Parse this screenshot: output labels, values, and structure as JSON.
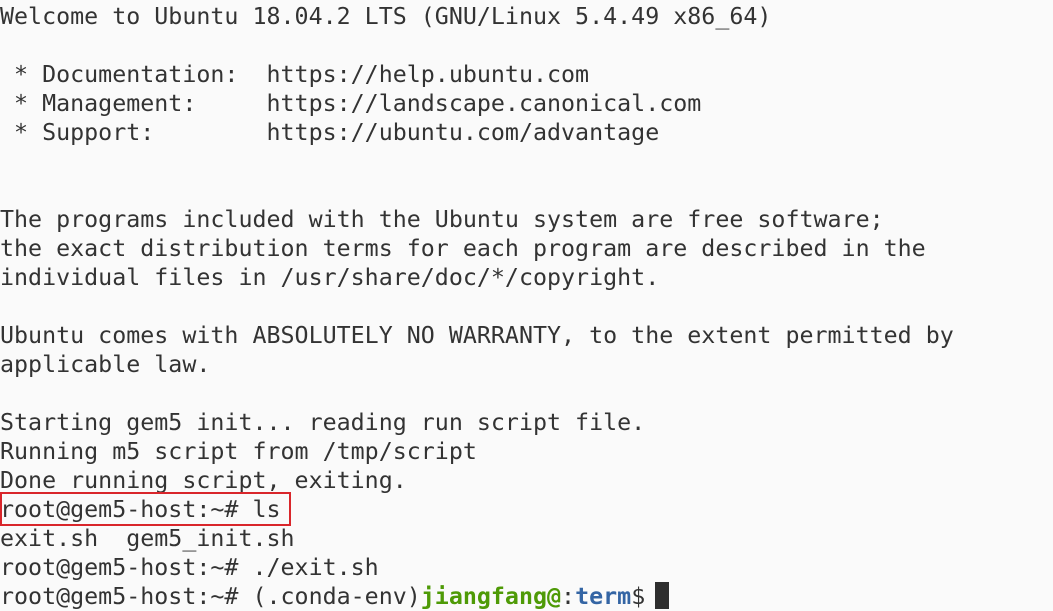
{
  "terminal": {
    "lines": [
      "Welcome to Ubuntu 18.04.2 LTS (GNU/Linux 5.4.49 x86_64)",
      "",
      " * Documentation:  https://help.ubuntu.com",
      " * Management:     https://landscape.canonical.com",
      " * Support:        https://ubuntu.com/advantage",
      "",
      "",
      "The programs included with the Ubuntu system are free software;",
      "the exact distribution terms for each program are described in the",
      "individual files in /usr/share/doc/*/copyright.",
      "",
      "Ubuntu comes with ABSOLUTELY NO WARRANTY, to the extent permitted by",
      "applicable law.",
      "",
      "Starting gem5 init... reading run script file.",
      "Running m5 script from /tmp/script",
      "Done running script, exiting.",
      "root@gem5-host:~# ls",
      "exit.sh  gem5_init.sh",
      "root@gem5-host:~# ./exit.sh"
    ],
    "prompt": {
      "root_prefix": "root@gem5-host:~# ",
      "env": "(.conda-env)",
      "user": "jiangfang@",
      "separator": ":",
      "dir": "term",
      "symbol": "$"
    }
  },
  "colors": {
    "background": "#fafafa",
    "text": "#333333",
    "user": "#4e9a06",
    "path": "#3465a4",
    "highlight": "#d9262b"
  }
}
